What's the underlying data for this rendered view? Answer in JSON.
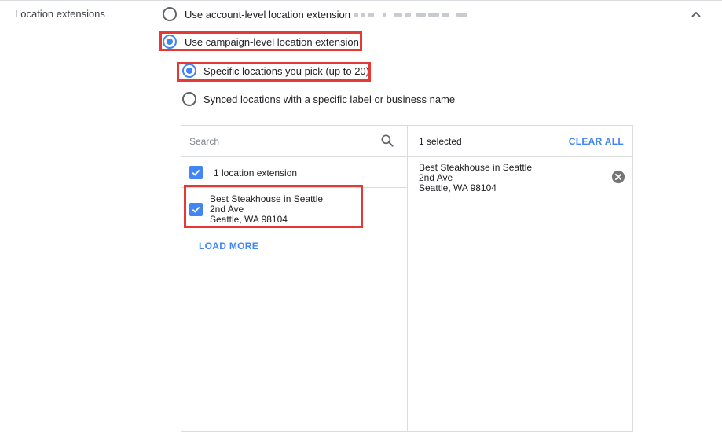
{
  "section": {
    "label": "Location extensions",
    "collapse_icon": "chevron-up-icon"
  },
  "options": {
    "account_level": "Use account-level location extension",
    "campaign_level": "Use campaign-level location extension",
    "specific": "Specific locations you pick (up to 20)",
    "synced": "Synced locations with a specific label or business name"
  },
  "picker": {
    "search_placeholder": "Search",
    "search_icon": "search-icon",
    "group_label": "1 location extension",
    "location": {
      "name": "Best Steakhouse in Seattle",
      "street": "2nd Ave",
      "city": "Seattle, WA 98104"
    },
    "load_more": "LOAD MORE",
    "selected_count": "1 selected",
    "clear_all": "CLEAR ALL",
    "selected_location": {
      "name": "Best Steakhouse in Seattle",
      "street": "2nd Ave",
      "city": "Seattle, WA 98104"
    },
    "remove_icon": "remove-circle-icon"
  },
  "colors": {
    "accent": "#4285f4",
    "highlight": "#e53935",
    "border": "#dadce0"
  }
}
